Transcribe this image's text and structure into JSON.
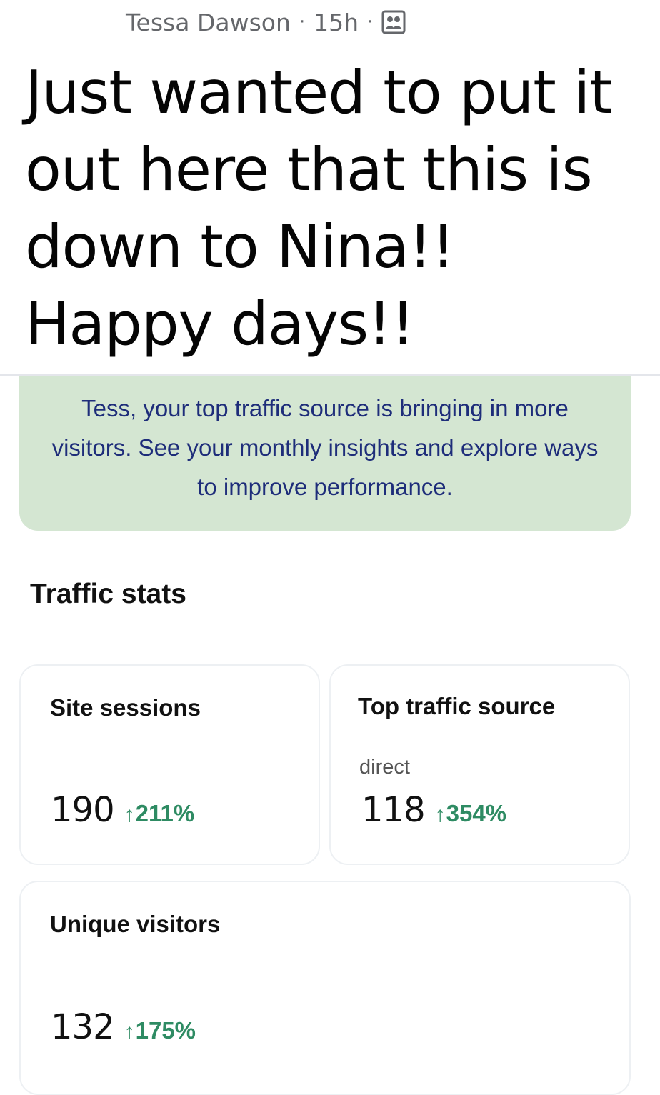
{
  "post": {
    "author": "Tessa Dawson",
    "separator": "·",
    "time": "15h",
    "audience_icon": "group-icon",
    "text": "Just wanted to put it out here that this is down to Nina!! Happy days!!"
  },
  "email": {
    "banner_text": "Tess, your top traffic source is bringing in more visitors. See your monthly insights and explore ways to improve performance.",
    "section_title": "Traffic stats",
    "accent_color": "#2e8b63",
    "banner_color": "#d4e6d2",
    "cards": [
      {
        "label": "Site sessions",
        "value": "190",
        "arrow": "↑",
        "change": "211%"
      },
      {
        "label": "Top traffic source",
        "sub": "direct",
        "value": "118",
        "arrow": "↑",
        "change": "354%"
      },
      {
        "label": "Unique visitors",
        "value": "132",
        "arrow": "↑",
        "change": "175%"
      }
    ]
  }
}
